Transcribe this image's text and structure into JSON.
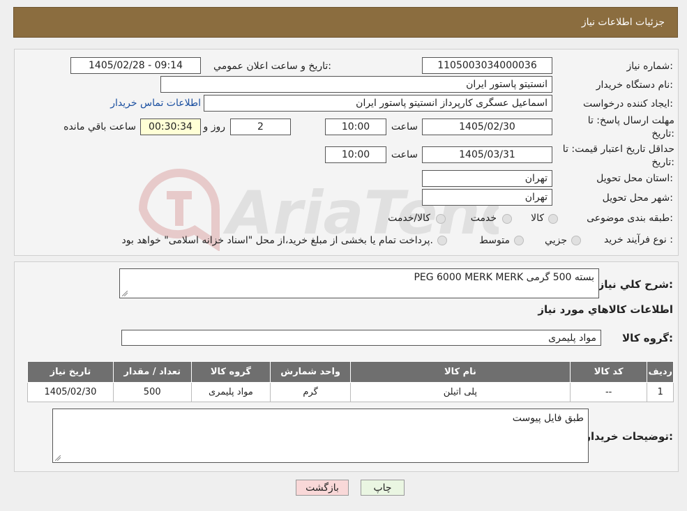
{
  "header": {
    "title": "جزئیات اطلاعات نیاز"
  },
  "form": {
    "need_number_label": "شماره نیاز:",
    "need_number": "1105003034000036",
    "announce_label": "تاریخ و ساعت اعلان عمومي:",
    "announce_value": "1405/02/28 - 09:14",
    "buyer_org_label": "نام دستگاه خريدار:",
    "buyer_org": "انستیتو پاستور ایران",
    "creator_label": "ايجاد كننده درخواست:",
    "creator": "اسماعیل عسگری کارپرداز انستیتو پاستور ایران",
    "contact_link": "اطلاعات تماس خريدار",
    "deadline_label": "مهلت ارسال پاسخ: تا تاريخ:",
    "deadline_date": "1405/02/30",
    "time_label": "ساعت",
    "deadline_time": "10:00",
    "days_value": "2",
    "days_label": "روز و",
    "remaining_value": "00:30:34",
    "remaining_label": "ساعت باقي مانده",
    "validity_label": "حداقل تاريخ اعتبار قيمت: تا تاريخ:",
    "validity_date": "1405/03/31",
    "validity_time": "10:00",
    "province_label": "استان محل تحويل:",
    "province": "تهران",
    "city_label": "شهر محل تحويل:",
    "city": "تهران",
    "category_label": "طبقه بندی موضوعی:",
    "category_options": [
      "كالا",
      "خدمت",
      "كالا/خدمت"
    ],
    "process_label": "نوع فرآيند خريد :",
    "process_options": [
      "جزيي",
      "متوسط"
    ],
    "process_note": "پرداخت تمام يا بخشی از مبلغ خريد،از محل \"اسناد خزانه اسلامی\" خواهد بود."
  },
  "description": {
    "label": "شرح كلي نياز:",
    "value": "PEG 6000 MERK MERK بسته 500 گرمی"
  },
  "goods": {
    "section_title": "اطلاعات كالاهاي مورد نياز",
    "group_label": "گروه كالا:",
    "group_value": "مواد پلیمری",
    "columns": [
      "رديف",
      "كد كالا",
      "نام كالا",
      "واحد شمارش",
      "گروه كالا",
      "تعداد / مقدار",
      "تاريخ نياز"
    ],
    "rows": [
      [
        "1",
        "--",
        "پلی اتیلن",
        "گرم",
        "مواد پلیمری",
        "500",
        "1405/02/30"
      ]
    ]
  },
  "buyer_notes": {
    "label": "توضيحات خريدار:",
    "value": "طبق فایل پیوست"
  },
  "buttons": {
    "print": "چاپ",
    "back": "بازگشت"
  },
  "colors": {
    "header": "#8b6d3f",
    "table_header": "#6f6f6f",
    "link": "#1a4fa0"
  }
}
